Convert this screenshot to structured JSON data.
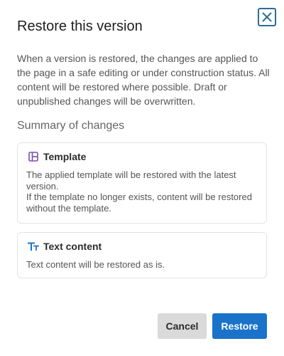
{
  "dialog": {
    "title": "Restore this version",
    "close_icon": "close-icon",
    "intro": "When a version is restored, the changes are applied to the page in a safe editing or under construction status. All content will be restored where possible. Draft or unpublished changes will be overwritten.",
    "summary_heading": "Summary of changes",
    "cards": [
      {
        "icon": "layout-template-icon",
        "icon_color": "#7b4fa8",
        "title": "Template",
        "lines": [
          "The applied template will be restored with the latest version.",
          "If the template no longer exists, content will be restored without the template."
        ]
      },
      {
        "icon": "text-size-icon",
        "icon_color": "#1a72c9",
        "title": "Text content",
        "lines": [
          "Text content will be restored as is."
        ]
      }
    ],
    "buttons": {
      "cancel_label": "Cancel",
      "restore_label": "Restore"
    }
  },
  "colors": {
    "primary": "#1a72c9",
    "close_border": "#2f6c97",
    "cancel_bg": "#dadada"
  }
}
